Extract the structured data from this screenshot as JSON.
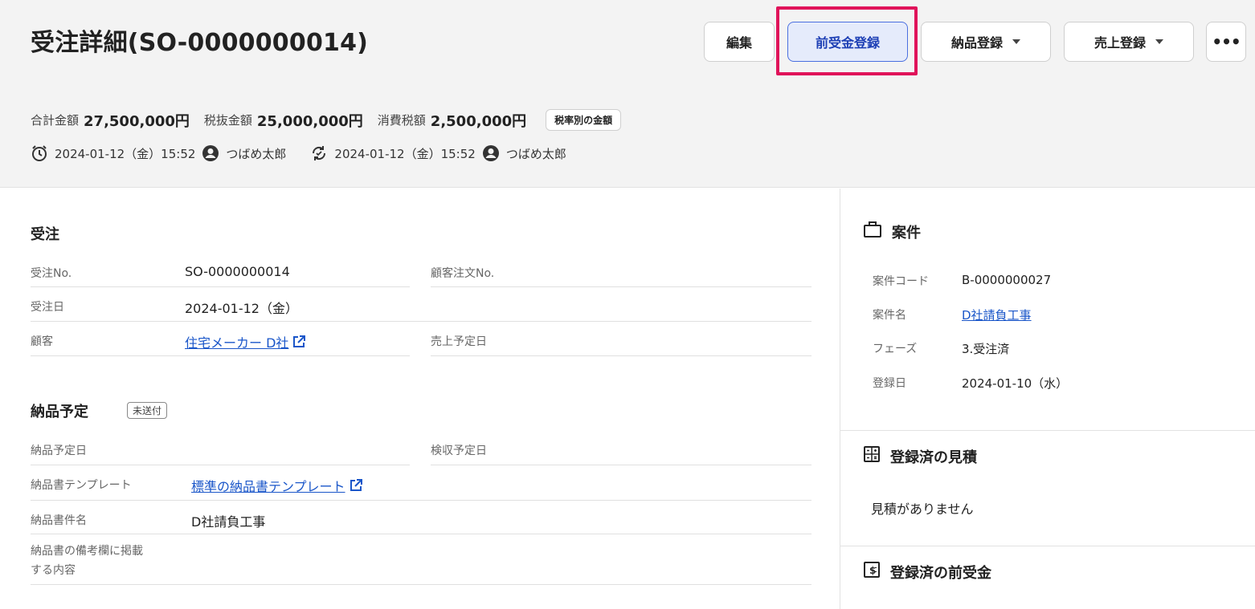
{
  "header": {
    "title": "受注詳細(SO-0000000014)",
    "buttons": {
      "edit": "編集",
      "advance_payment": "前受金登録",
      "delivery": "納品登録",
      "sales": "売上登録",
      "more": "•••"
    },
    "amounts": {
      "total_label": "合計金額",
      "total_value": "27,500,000円",
      "pretax_label": "税抜金額",
      "pretax_value": "25,000,000円",
      "tax_label": "消費税額",
      "tax_value": "2,500,000円",
      "tax_breakdown_button": "税率別の金額"
    },
    "meta": {
      "created_at": "2024-01-12（金）15:52",
      "created_by": "つばめ太郎",
      "updated_at": "2024-01-12（金）15:52",
      "updated_by": "つばめ太郎"
    }
  },
  "order": {
    "section_title": "受注",
    "order_no_label": "受注No.",
    "order_no": "SO-0000000014",
    "customer_order_no_label": "顧客注文No.",
    "customer_order_no": "",
    "order_date_label": "受注日",
    "order_date": "2024-01-12（金）",
    "customer_label": "顧客",
    "customer": "住宅メーカー D社",
    "sales_date_label": "売上予定日",
    "sales_date": ""
  },
  "delivery": {
    "section_title": "納品予定",
    "status": "未送付",
    "delivery_date_label": "納品予定日",
    "inspection_date_label": "検収予定日",
    "template_label": "納品書テンプレート",
    "template": "標準の納品書テンプレート",
    "doc_name_label": "納品書件名",
    "doc_name": "D社請負工事",
    "remarks_label_1": "納品書の備考欄に掲載",
    "remarks_label_2": "する内容"
  },
  "project": {
    "section_title": "案件",
    "code_label": "案件コード",
    "code": "B-0000000027",
    "name_label": "案件名",
    "name": "D社請負工事",
    "phase_label": "フェーズ",
    "phase": "3.受注済",
    "registered_label": "登録日",
    "registered": "2024-01-10（水）"
  },
  "estimates": {
    "section_title": "登録済の見積",
    "empty_text": "見積がありません"
  },
  "advances": {
    "section_title": "登録済の前受金"
  },
  "colors": {
    "primary_link": "#1a56c9",
    "highlight": "#e0135a",
    "active_button_bg": "#e5ebfb"
  }
}
